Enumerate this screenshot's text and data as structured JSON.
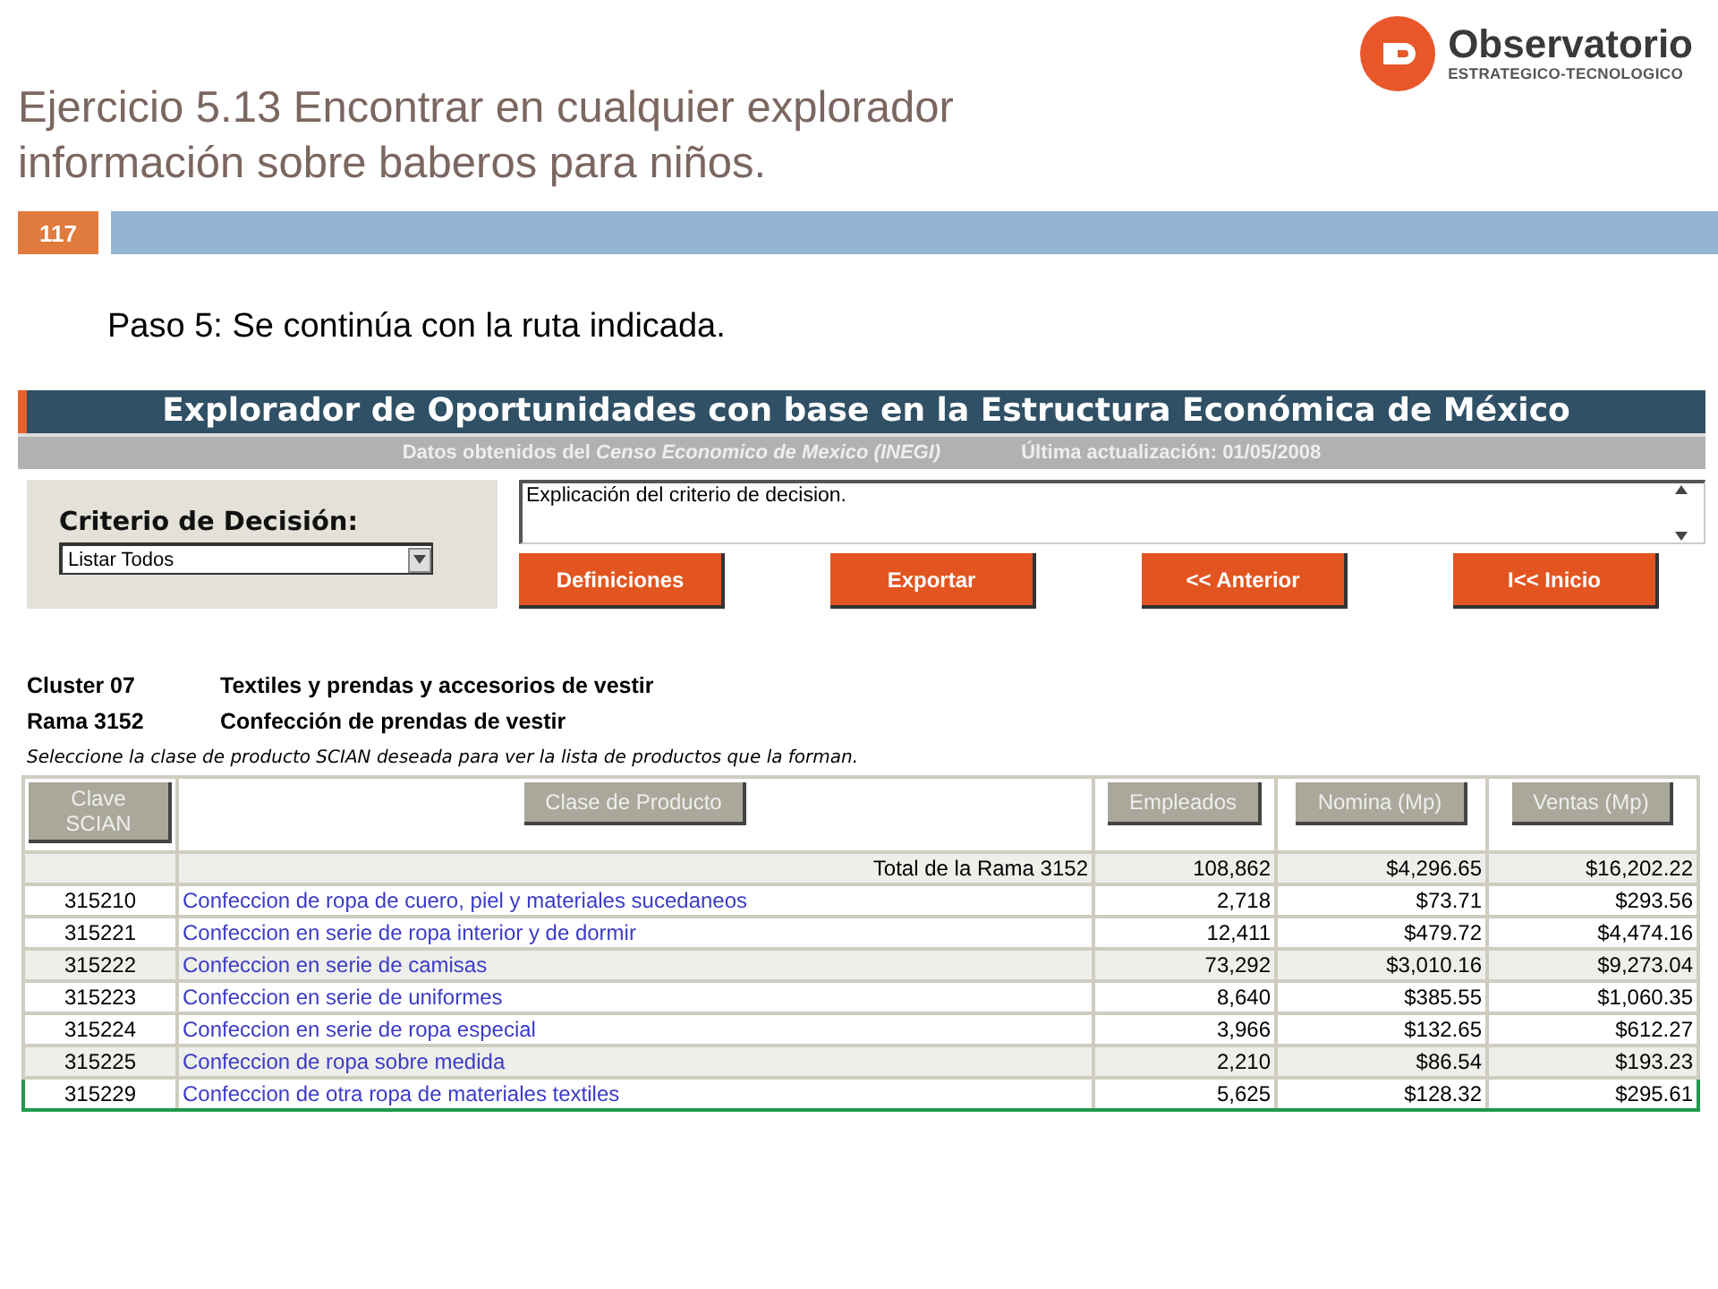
{
  "logo": {
    "name": "Observatorio",
    "tagline": "ESTRATEGICO-TECNOLOGICO"
  },
  "slide": {
    "title_lines": [
      "Ejercicio 5.13 Encontrar en cualquier explorador",
      "información sobre baberos para niños."
    ],
    "page_number": "117",
    "step": "Paso 5: Se continúa con la ruta indicada."
  },
  "app": {
    "title": "Explorador de Oportunidades con base en la Estructura Económica de México",
    "source": "Datos obtenidos del *Censo Economico de Mexico (INEGI)*",
    "updated": "Última actualización: 01/05/2008",
    "criterion_label": "Criterio de Decisión:",
    "criterion_value": "Listar Todos",
    "explanation": "Explicación del criterio de decision.",
    "buttons": [
      "Definiciones",
      "Exportar",
      "<< Anterior",
      "I<< Inicio"
    ],
    "info": [
      {
        "label": "Cluster 07",
        "value": "Textiles y prendas y accesorios de vestir"
      },
      {
        "label": "Rama 3152",
        "value": "Confección de prendas de vestir"
      }
    ],
    "instruction": "Seleccione la clase de producto SCIAN deseada para ver la lista de productos que la forman.",
    "table": {
      "columns": [
        "Clave SCIAN",
        "Clase de Producto",
        "Empleados",
        "Nomina  (Mp)",
        "Ventas  (Mp)"
      ],
      "total": {
        "label": "Total de la Rama 3152",
        "empleados": "108,862",
        "nomina": "$4,296.65",
        "ventas": "$16,202.22"
      },
      "rows": [
        {
          "code": "315210",
          "name": "Confeccion de ropa de cuero, piel y materiales sucedaneos",
          "empleados": "2,718",
          "nomina": "$73.71",
          "ventas": "$293.56",
          "highlighted": false
        },
        {
          "code": "315221",
          "name": "Confeccion en serie de ropa interior y de dormir",
          "empleados": "12,411",
          "nomina": "$479.72",
          "ventas": "$4,474.16",
          "highlighted": false
        },
        {
          "code": "315222",
          "name": "Confeccion en serie de camisas",
          "empleados": "73,292",
          "nomina": "$3,010.16",
          "ventas": "$9,273.04",
          "highlighted": false
        },
        {
          "code": "315223",
          "name": "Confeccion en serie de uniformes",
          "empleados": "8,640",
          "nomina": "$385.55",
          "ventas": "$1,060.35",
          "highlighted": false
        },
        {
          "code": "315224",
          "name": "Confeccion en serie de ropa especial",
          "empleados": "3,966",
          "nomina": "$132.65",
          "ventas": "$612.27",
          "highlighted": false
        },
        {
          "code": "315225",
          "name": "Confeccion de ropa sobre medida",
          "empleados": "2,210",
          "nomina": "$86.54",
          "ventas": "$193.23",
          "highlighted": false
        },
        {
          "code": "315229",
          "name": "Confeccion de otra ropa de materiales textiles",
          "empleados": "5,625",
          "nomina": "$128.32",
          "ventas": "$295.61",
          "highlighted": true
        }
      ]
    }
  }
}
